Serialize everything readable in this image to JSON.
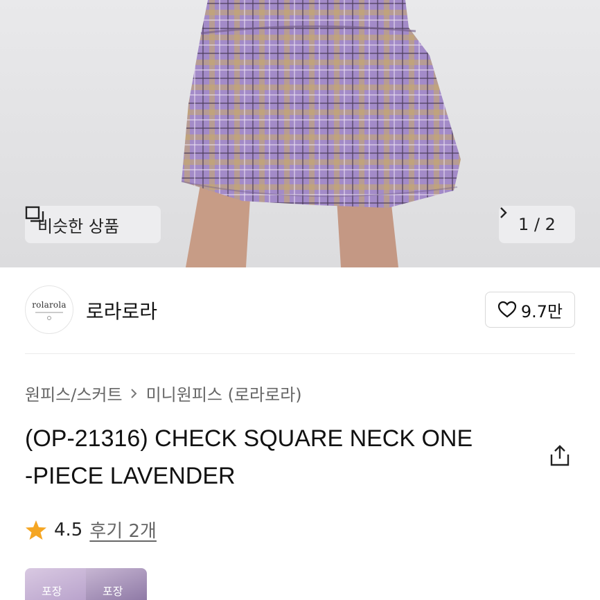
{
  "hero": {
    "similar_button_label": "비슷한 상품",
    "pager_text": "1 / 2"
  },
  "shop": {
    "logo_text": "rolarola",
    "name": "로라로라",
    "likes": "9.7만"
  },
  "breadcrumb": {
    "category": "원피스/스커트",
    "subcategory": "미니원피스 (로라로라)"
  },
  "product": {
    "title_line1": "(OP-21316) CHECK SQUARE NECK ONE",
    "title_line2": "-PIECE LAVENDER"
  },
  "rating": {
    "score": "4.5",
    "reviews": "후기 2개"
  },
  "thumbnails": [
    {
      "label": "포장"
    },
    {
      "label": "포장"
    }
  ],
  "colors": {
    "star": "#f5a623",
    "plaid": "#a48ac9"
  }
}
